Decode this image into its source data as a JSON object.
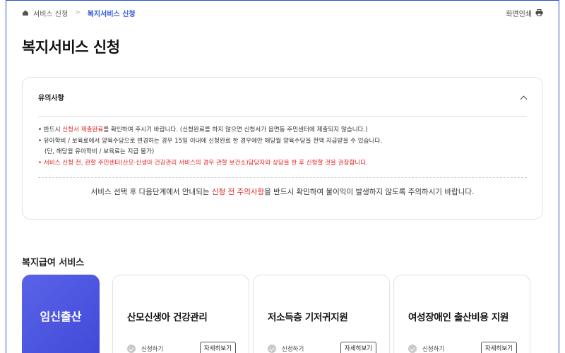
{
  "breadcrumb": {
    "home": "서비스 신청",
    "current": "복지서비스 신청"
  },
  "print_label": "화면인쇄",
  "page_title": "복지서비스 신청",
  "notice": {
    "title": "유의사항",
    "line1_a": "• 반드시 ",
    "line1_red": "신청서 제출완료",
    "line1_b": "를 확인하여 주시기 바랍니다. (신청완료를 하지 않으면 신청서가 읍면동 주민센터에 제출되지 않습니다.)",
    "line2": "• 유아학비 / 보육료에서 양육수당으로 변경하는 경우 15일 이내에 신청완료 한 경우에만 해당월 양육수당을 전액 지급받을 수 있습니다.",
    "line3": "(단, 해당월 유아학비 / 보육료는 지급 불가)",
    "line4": "• 서비스 신청 전, 관할 주민센터(산모·신생아 건강관리 서비스의 경우 관할 보건소)담당자와 상담을 한 후 신청할 것을 권장합니다.",
    "final_a": "서비스 선택 후 다음단계에서 안내되는 ",
    "final_red": "신청 전 주의사항",
    "final_b": "을 반드시 확인하여 불이익이 발생하지 않도록 주의하시기 바랍니다."
  },
  "section_title": "복지급여 서비스",
  "category": {
    "label": "임신출산",
    "color": "#4b53df"
  },
  "services": [
    {
      "title": "산모신생아 건강관리",
      "apply": "신청하기",
      "detail": "자세히보기"
    },
    {
      "title": "저소득층 기저귀지원",
      "apply": "신청하기",
      "detail": "자세히보기"
    },
    {
      "title": "여성장애인 출산비용 지원",
      "apply": "신청하기",
      "detail": "자세히보기"
    }
  ],
  "colors": {
    "accent": "#3357d6",
    "warning": "#e02424"
  }
}
